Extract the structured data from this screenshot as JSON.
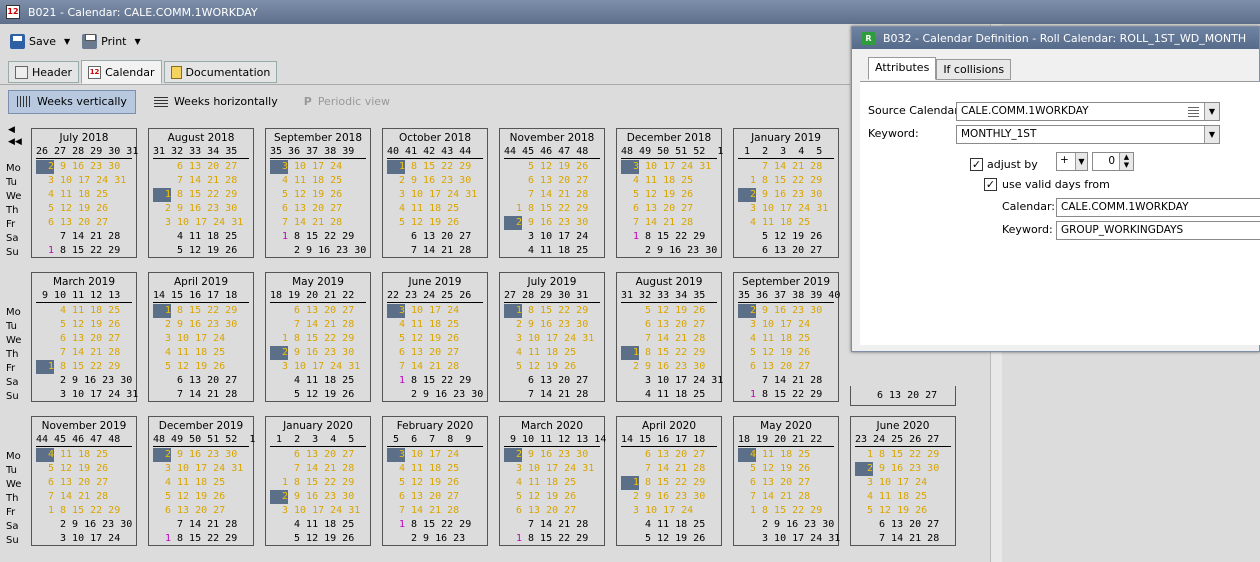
{
  "window": {
    "title": "B021 - Calendar: CALE.COMM.1WORKDAY",
    "icon_text": "12"
  },
  "toolbar": {
    "save_label": "Save",
    "print_label": "Print"
  },
  "tabs": [
    {
      "label": "Header"
    },
    {
      "label": "Calendar"
    },
    {
      "label": "Documentation"
    }
  ],
  "views": [
    {
      "label": "Weeks vertically"
    },
    {
      "label": "Weeks horizontally"
    },
    {
      "label": "Periodic view"
    }
  ],
  "nav": {
    "prev": "◀",
    "first": "◀◀"
  },
  "day_labels": [
    "Mo",
    "Tu",
    "We",
    "Th",
    "Fr",
    "Sa",
    "Su"
  ],
  "months": [
    {
      "title": "July  2018",
      "weeks": "26 27 28 29 30 31",
      "rows": [
        [
          "",
          "{2}",
          "9 16 23 30"
        ],
        [
          "",
          "3",
          "10 17 24 31"
        ],
        [
          "",
          "4",
          "11 18 25"
        ],
        [
          "",
          "5",
          "12 19 26"
        ],
        [
          "",
          "6",
          "13 20 27"
        ],
        [
          "w",
          "",
          "7 14 21 28"
        ],
        [
          "m1",
          "",
          "8 15 22 29"
        ]
      ]
    },
    {
      "title": "August  2018",
      "weeks": "31 32 33 34 35",
      "rows": [
        [
          "",
          "",
          "6 13 20 27"
        ],
        [
          "",
          "",
          "7 14 21 28"
        ],
        [
          "",
          "{1}",
          "8 15 22 29"
        ],
        [
          "",
          "2",
          "9 16 23 30"
        ],
        [
          "",
          "3",
          "10 17 24 31"
        ],
        [
          "w",
          "",
          "4 11 18 25"
        ],
        [
          "w",
          "",
          "5 12 19 26"
        ]
      ]
    },
    {
      "title": "September  2018",
      "weeks": "35 36 37 38 39",
      "rows": [
        [
          "",
          "{3}",
          "10 17 24"
        ],
        [
          "",
          "4",
          "11 18 25"
        ],
        [
          "",
          "5",
          "12 19 26"
        ],
        [
          "",
          "6",
          "13 20 27"
        ],
        [
          "",
          "7",
          "14 21 28"
        ],
        [
          "m1",
          "",
          "8 15 22 29"
        ],
        [
          "w",
          "",
          "2 9 16 23 30"
        ]
      ]
    },
    {
      "title": "October  2018",
      "weeks": "40 41 42 43 44",
      "rows": [
        [
          "",
          "{1}",
          "8 15 22 29"
        ],
        [
          "",
          "2",
          "9 16 23 30"
        ],
        [
          "",
          "3",
          "10 17 24 31"
        ],
        [
          "",
          "4",
          "11 18 25"
        ],
        [
          "",
          "5",
          "12 19 26"
        ],
        [
          "w",
          "",
          "6 13 20 27"
        ],
        [
          "w",
          "",
          "7 14 21 28"
        ]
      ]
    },
    {
      "title": "November  2018",
      "weeks": "44 45 46 47 48",
      "rows": [
        [
          "",
          "",
          "5 12 19 26"
        ],
        [
          "",
          "",
          "6 13 20 27"
        ],
        [
          "",
          "",
          "7 14 21 28"
        ],
        [
          "",
          "1",
          "8 15 22 29"
        ],
        [
          "",
          "{2}",
          "9 16 23 30"
        ],
        [
          "w",
          "",
          "3 10 17 24"
        ],
        [
          "w",
          "",
          "4 11 18 25"
        ]
      ]
    },
    {
      "title": "December  2018",
      "weeks": "48 49 50 51 52  1",
      "rows": [
        [
          "",
          "{3}",
          "10 17 24 31"
        ],
        [
          "",
          "4",
          "11 18 25"
        ],
        [
          "",
          "5",
          "12 19 26"
        ],
        [
          "",
          "6",
          "13 20 27"
        ],
        [
          "",
          "7",
          "14 21 28"
        ],
        [
          "m1",
          "",
          "8 15 22 29"
        ],
        [
          "w",
          "",
          "2 9 16 23 30"
        ]
      ]
    },
    {
      "title": "January  2019",
      "weeks": " 1  2  3  4  5",
      "rows": [
        [
          "",
          "",
          "7 14 21 28"
        ],
        [
          "",
          "1",
          "8 15 22 29"
        ],
        [
          "",
          "{2}",
          "9 16 23 30"
        ],
        [
          "",
          "3",
          "10 17 24 31"
        ],
        [
          "",
          "4",
          "11 18 25"
        ],
        [
          "w",
          "",
          "5 12 19 26"
        ],
        [
          "w",
          "",
          "6 13 20 27"
        ]
      ]
    },
    {
      "title": "March  2019",
      "weeks": " 9 10 11 12 13",
      "rows": [
        [
          "",
          "",
          "4 11 18 25"
        ],
        [
          "",
          "",
          "5 12 19 26"
        ],
        [
          "",
          "",
          "6 13 20 27"
        ],
        [
          "",
          "",
          "7 14 21 28"
        ],
        [
          "",
          "{1}",
          "8 15 22 29"
        ],
        [
          "w",
          "",
          "2 9 16 23 30"
        ],
        [
          "w",
          "",
          "3 10 17 24 31"
        ]
      ]
    },
    {
      "title": "April  2019",
      "weeks": "14 15 16 17 18",
      "rows": [
        [
          "",
          "{1}",
          "8 15 22 29"
        ],
        [
          "",
          "2",
          "9 16 23 30"
        ],
        [
          "",
          "3",
          "10 17 24"
        ],
        [
          "",
          "4",
          "11 18 25"
        ],
        [
          "",
          "5",
          "12 19 26"
        ],
        [
          "w",
          "",
          "6 13 20 27"
        ],
        [
          "w",
          "",
          "7 14 21 28"
        ]
      ]
    },
    {
      "title": "May  2019",
      "weeks": "18 19 20 21 22",
      "rows": [
        [
          "",
          "",
          "6 13 20 27"
        ],
        [
          "",
          "",
          "7 14 21 28"
        ],
        [
          "",
          "1",
          "8 15 22 29"
        ],
        [
          "",
          "{2}",
          "9 16 23 30"
        ],
        [
          "",
          "3",
          "10 17 24 31"
        ],
        [
          "w",
          "",
          "4 11 18 25"
        ],
        [
          "w",
          "",
          "5 12 19 26"
        ]
      ]
    },
    {
      "title": "June  2019",
      "weeks": "22 23 24 25 26",
      "rows": [
        [
          "",
          "{3}",
          "10 17 24"
        ],
        [
          "",
          "4",
          "11 18 25"
        ],
        [
          "",
          "5",
          "12 19 26"
        ],
        [
          "",
          "6",
          "13 20 27"
        ],
        [
          "",
          "7",
          "14 21 28"
        ],
        [
          "m1",
          "",
          "8 15 22 29"
        ],
        [
          "w",
          "",
          "2 9 16 23 30"
        ]
      ]
    },
    {
      "title": "July  2019",
      "weeks": "27 28 29 30 31",
      "rows": [
        [
          "",
          "{1}",
          "8 15 22 29"
        ],
        [
          "",
          "2",
          "9 16 23 30"
        ],
        [
          "",
          "3",
          "10 17 24 31"
        ],
        [
          "",
          "4",
          "11 18 25"
        ],
        [
          "",
          "5",
          "12 19 26"
        ],
        [
          "w",
          "",
          "6 13 20 27"
        ],
        [
          "w",
          "",
          "7 14 21 28"
        ]
      ]
    },
    {
      "title": "August  2019",
      "weeks": "31 32 33 34 35",
      "rows": [
        [
          "",
          "",
          "5 12 19 26"
        ],
        [
          "",
          "",
          "6 13 20 27"
        ],
        [
          "",
          "",
          "7 14 21 28"
        ],
        [
          "",
          "{1}",
          "8 15 22 29"
        ],
        [
          "",
          "2",
          "9 16 23 30"
        ],
        [
          "w",
          "",
          "3 10 17 24 31"
        ],
        [
          "w",
          "",
          "4 11 18 25"
        ]
      ]
    },
    {
      "title": "September  2019",
      "weeks": "35 36 37 38 39 40",
      "rows": [
        [
          "",
          "{2}",
          "9 16 23 30"
        ],
        [
          "",
          "3",
          "10 17 24"
        ],
        [
          "",
          "4",
          "11 18 25"
        ],
        [
          "",
          "5",
          "12 19 26"
        ],
        [
          "",
          "6",
          "13 20 27"
        ],
        [
          "w",
          "",
          "7 14 21 28"
        ],
        [
          "m1",
          "",
          "8 15 22 29"
        ]
      ]
    },
    {
      "title": "November  2019",
      "weeks": "44 45 46 47 48",
      "rows": [
        [
          "",
          "{4}",
          "11 18 25"
        ],
        [
          "",
          "5",
          "12 19 26"
        ],
        [
          "",
          "6",
          "13 20 27"
        ],
        [
          "",
          "7",
          "14 21 28"
        ],
        [
          "",
          "1",
          "8 15 22 29"
        ],
        [
          "w",
          "",
          "2 9 16 23 30"
        ],
        [
          "w",
          "",
          "3 10 17 24"
        ]
      ]
    },
    {
      "title": "December  2019",
      "weeks": "48 49 50 51 52  1",
      "rows": [
        [
          "",
          "{2}",
          "9 16 23 30"
        ],
        [
          "",
          "3",
          "10 17 24 31"
        ],
        [
          "",
          "4",
          "11 18 25"
        ],
        [
          "",
          "5",
          "12 19 26"
        ],
        [
          "",
          "6",
          "13 20 27"
        ],
        [
          "w",
          "",
          "7 14 21 28"
        ],
        [
          "m1",
          "",
          "8 15 22 29"
        ]
      ]
    },
    {
      "title": "January  2020",
      "weeks": " 1  2  3  4  5",
      "rows": [
        [
          "",
          "",
          "6 13 20 27"
        ],
        [
          "",
          "",
          "7 14 21 28"
        ],
        [
          "",
          "1",
          "8 15 22 29"
        ],
        [
          "",
          "{2}",
          "9 16 23 30"
        ],
        [
          "",
          "3",
          "10 17 24 31"
        ],
        [
          "w",
          "",
          "4 11 18 25"
        ],
        [
          "w",
          "",
          "5 12 19 26"
        ]
      ]
    },
    {
      "title": "February  2020",
      "weeks": " 5  6  7  8  9",
      "rows": [
        [
          "",
          "{3}",
          "10 17 24"
        ],
        [
          "",
          "4",
          "11 18 25"
        ],
        [
          "",
          "5",
          "12 19 26"
        ],
        [
          "",
          "6",
          "13 20 27"
        ],
        [
          "",
          "7",
          "14 21 28"
        ],
        [
          "m1",
          "",
          "8 15 22 29"
        ],
        [
          "w",
          "",
          "2 9 16 23"
        ]
      ]
    },
    {
      "title": "March  2020",
      "weeks": " 9 10 11 12 13 14",
      "rows": [
        [
          "",
          "{2}",
          "9 16 23 30"
        ],
        [
          "",
          "3",
          "10 17 24 31"
        ],
        [
          "",
          "4",
          "11 18 25"
        ],
        [
          "",
          "5",
          "12 19 26"
        ],
        [
          "",
          "6",
          "13 20 27"
        ],
        [
          "w",
          "",
          "7 14 21 28"
        ],
        [
          "m1",
          "",
          "8 15 22 29"
        ]
      ]
    },
    {
      "title": "April  2020",
      "weeks": "14 15 16 17 18",
      "rows": [
        [
          "",
          "",
          "6 13 20 27"
        ],
        [
          "",
          "",
          "7 14 21 28"
        ],
        [
          "",
          "{1}",
          "8 15 22 29"
        ],
        [
          "",
          "2",
          "9 16 23 30"
        ],
        [
          "",
          "3",
          "10 17 24"
        ],
        [
          "w",
          "",
          "4 11 18 25"
        ],
        [
          "w",
          "",
          "5 12 19 26"
        ]
      ]
    },
    {
      "title": "May  2020",
      "weeks": "18 19 20 21 22",
      "rows": [
        [
          "",
          "{4}",
          "11 18 25"
        ],
        [
          "",
          "5",
          "12 19 26"
        ],
        [
          "",
          "6",
          "13 20 27"
        ],
        [
          "",
          "7",
          "14 21 28"
        ],
        [
          "",
          "1",
          "8 15 22 29"
        ],
        [
          "w",
          "",
          "2 9 16 23 30"
        ],
        [
          "w",
          "",
          "3 10 17 24 31"
        ]
      ]
    },
    {
      "title": "June  2020",
      "weeks": "23 24 25 26 27",
      "rows": [
        [
          "",
          "1",
          "8 15 22 29"
        ],
        [
          "",
          "{2}",
          "9 16 23 30"
        ],
        [
          "",
          "3",
          "10 17 24"
        ],
        [
          "",
          "4",
          "11 18 25"
        ],
        [
          "",
          "5",
          "12 19 26"
        ],
        [
          "w",
          "",
          "6 13 20 27"
        ],
        [
          "w",
          "",
          "7 14 21 28"
        ]
      ]
    }
  ],
  "popup": {
    "title": "B032 - Calendar Definition - Roll Calendar: ROLL_1ST_WD_MONTH",
    "icon_text": "R",
    "tabs": [
      {
        "label": "Attributes"
      },
      {
        "label": "If collisions"
      }
    ],
    "source_calendar_label": "Source Calendar:",
    "source_calendar_value": "CALE.COMM.1WORKDAY",
    "keyword_label": "Keyword:",
    "keyword_value": "MONTHLY_1ST",
    "adjust_by_label": "adjust by",
    "adjust_sign": "+",
    "adjust_value": "0",
    "use_valid_days_label": "use valid days from",
    "calendar_label": "Calendar:",
    "calendar_value": "CALE.COMM.1WORKDAY",
    "keyword2_label": "Keyword:",
    "keyword2_value": "GROUP_WORKINGDAYS",
    "partial_month_text": "6 13 20 27"
  },
  "colors": {
    "workday": "#d9a400",
    "holiday": "#c000c0",
    "selected_bg": "#5c6f88"
  }
}
